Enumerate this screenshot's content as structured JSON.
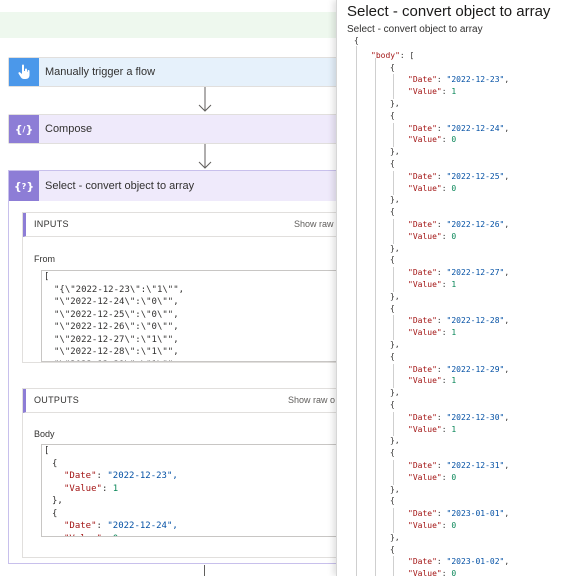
{
  "flow": {
    "trigger": {
      "label": "Manually trigger a flow",
      "icon": "hand-pointer-icon"
    },
    "compose": {
      "label": "Compose",
      "icon": "curly-braces-icon"
    },
    "select": {
      "label": "Select - convert object to array",
      "icon": "curly-braces-icon",
      "inputs": {
        "title": "INPUTS",
        "show_raw": "Show raw",
        "from_label": "From",
        "lines": [
          "[",
          "\"{\\\"2022-12-23\\\":\\\"1\\\"\",",
          "\"\\\"2022-12-24\\\":\\\"0\\\"\",",
          "\"\\\"2022-12-25\\\":\\\"0\\\"\",",
          "\"\\\"2022-12-26\\\":\\\"0\\\"\",",
          "\"\\\"2022-12-27\\\":\\\"1\\\"\",",
          "\"\\\"2022-12-28\\\":\\\"1\\\"\",",
          "\"\\\"2022-12-29\\\":\\\"1\\\"\","
        ]
      },
      "outputs": {
        "title": "OUTPUTS",
        "show_raw": "Show raw o",
        "body_label": "Body",
        "lines": [
          "[",
          "{",
          "\"Date\": \"2022-12-23\",",
          "\"Value\": 1",
          "},",
          "{",
          "\"Date\": \"2022-12-24\",",
          "\"Value\": 0"
        ]
      }
    }
  },
  "right_pane": {
    "title": "Select - convert object to array",
    "subtitle": "Select - convert object to array",
    "open_brace": "{",
    "body_key": "\"body\"",
    "body_punct": ": [",
    "date_key": "\"Date\"",
    "value_key": "\"Value\"",
    "records": [
      {
        "date": "\"2022-12-23\"",
        "value": "1"
      },
      {
        "date": "\"2022-12-24\"",
        "value": "0"
      },
      {
        "date": "\"2022-12-25\"",
        "value": "0"
      },
      {
        "date": "\"2022-12-26\"",
        "value": "0"
      },
      {
        "date": "\"2022-12-27\"",
        "value": "1"
      },
      {
        "date": "\"2022-12-28\"",
        "value": "1"
      },
      {
        "date": "\"2022-12-29\"",
        "value": "1"
      },
      {
        "date": "\"2022-12-30\"",
        "value": "1"
      },
      {
        "date": "\"2022-12-31\"",
        "value": "0"
      },
      {
        "date": "\"2023-01-01\"",
        "value": "0"
      },
      {
        "date": "\"2023-01-02\"",
        "value": "0"
      }
    ]
  },
  "colors": {
    "trigger_accent": "#4b98ea",
    "action_accent": "#8d7dd6",
    "json_key": "#a31515",
    "json_string": "#0451a5",
    "json_number": "#098658"
  }
}
